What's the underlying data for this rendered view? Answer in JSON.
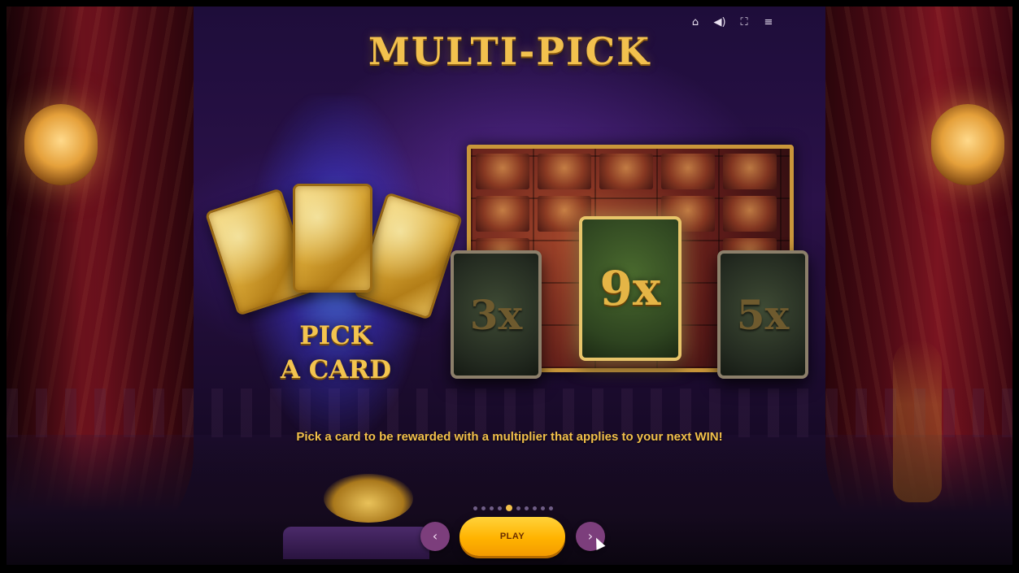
{
  "header": {
    "title": "MULTI-PICK",
    "icons": [
      "home-icon",
      "sound-icon",
      "fullscreen-icon",
      "menu-icon"
    ]
  },
  "intro": {
    "pick_line1": "PICK",
    "pick_line2": "A CARD"
  },
  "multiplier_cards": [
    {
      "label": "3x",
      "state": "dim"
    },
    {
      "label": "9x",
      "state": "selected"
    },
    {
      "label": "5x",
      "state": "dim"
    }
  ],
  "caption": "Pick a card to be rewarded with a multiplier that applies to your next WIN!",
  "controls": {
    "prev_label": "‹",
    "play_label": "PLAY",
    "next_label": "›",
    "page_count": 10,
    "active_page": 4
  },
  "colors": {
    "gold": "#f2c04a",
    "play_button": "#ffb300",
    "nav_button": "#7c3e7c"
  }
}
